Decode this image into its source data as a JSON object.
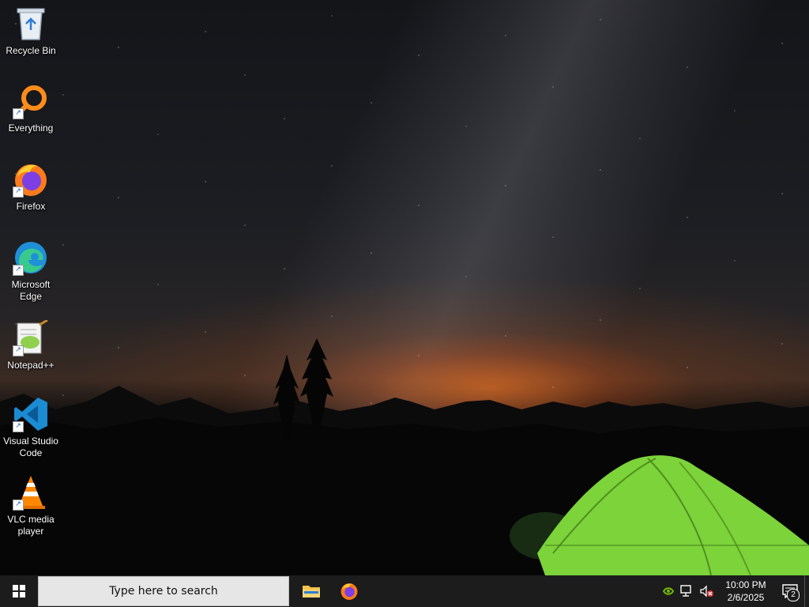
{
  "desktop": {
    "icons": [
      {
        "label": "Recycle Bin",
        "icon": "recycle-bin-icon",
        "shortcut": false
      },
      {
        "label": "Everything",
        "icon": "everything-search-icon",
        "shortcut": true
      },
      {
        "label": "Firefox",
        "icon": "firefox-icon",
        "shortcut": true
      },
      {
        "label": "Microsoft Edge",
        "icon": "edge-icon",
        "shortcut": true
      },
      {
        "label": "Notepad++",
        "icon": "notepadpp-icon",
        "shortcut": true
      },
      {
        "label": "Visual Studio Code",
        "icon": "vscode-icon",
        "shortcut": true
      },
      {
        "label": "VLC media player",
        "icon": "vlc-icon",
        "shortcut": true
      }
    ],
    "shortcut_glyph": "↗"
  },
  "taskbar": {
    "search_placeholder": "Type here to search",
    "pinned": [
      {
        "name": "File Explorer",
        "icon": "folder-icon"
      },
      {
        "name": "Firefox",
        "icon": "firefox-icon"
      }
    ],
    "tray": {
      "icons": [
        "nvidia-icon",
        "network-icon",
        "volume-muted-icon"
      ],
      "time": "10:00 PM",
      "date": "2/6/2025",
      "notification_count": "2"
    }
  },
  "colors": {
    "taskbar": "#1c1c1c",
    "search_box": "#e6e6e6",
    "tent_green": "#7cd33a"
  }
}
